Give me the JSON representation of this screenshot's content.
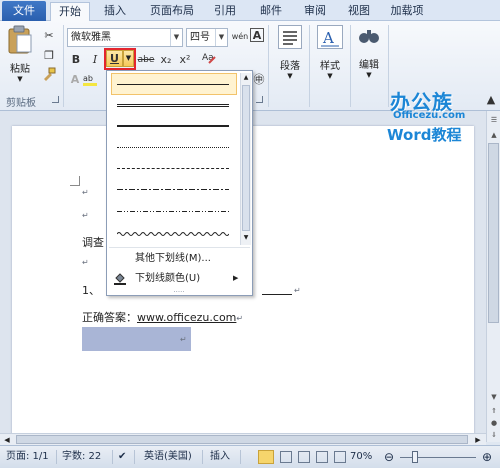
{
  "tabs": {
    "file": "文件",
    "home": "开始",
    "insert": "插入",
    "layout": "页面布局",
    "references": "引用",
    "mailings": "邮件",
    "review": "审阅",
    "view": "视图",
    "addins": "加载项"
  },
  "ribbon": {
    "paste_label": "粘贴",
    "clipboard_group": "剪贴板",
    "font_name": "微软雅黑",
    "font_size": "四号",
    "bold": "B",
    "italic": "I",
    "underline": "U",
    "strike": "abe",
    "subscript": "x₂",
    "superscript": "x²",
    "paragraph_label": "段落",
    "styles_label": "样式",
    "editing_label": "编辑"
  },
  "underline_menu": {
    "more_underlines": "其他下划线(M)...",
    "underline_color": "下划线颜色(U)",
    "styles": [
      "single",
      "double",
      "thick",
      "dotted",
      "dashed",
      "dash-dot",
      "dash-dot-dot",
      "wave"
    ]
  },
  "document": {
    "line_quiz": "调查",
    "line_one": "1、",
    "answer_label": "正确答案：",
    "answer_value": "www.officezu.com",
    "paragraph_mark": "↵"
  },
  "watermark": {
    "brand": "办公族",
    "site": "Officezu.com",
    "tagline": "Word教程"
  },
  "status": {
    "page": "页面: 1/1",
    "words": "字数: 22",
    "language": "英语(美国)",
    "mode": "插入",
    "zoom": "70%"
  },
  "colors": {
    "file_tab": "#2a5fae",
    "highlight_box": "#e3262e",
    "selection": "#a9b5d6",
    "watermark": "#1c86d6"
  }
}
